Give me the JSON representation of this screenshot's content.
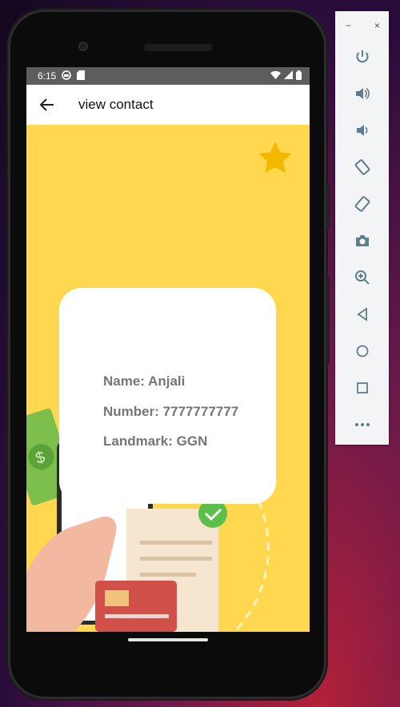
{
  "status_bar": {
    "time": "6:15"
  },
  "app_bar": {
    "title": "view contact",
    "back_icon": "arrow-back-icon"
  },
  "contact": {
    "name_line": "Name: Anjali",
    "number_line": "Number: 7777777777",
    "landmark_line": "Landmark: GGN"
  },
  "favorite_icon": "star-icon",
  "colors": {
    "screen_background": "#ffd84f",
    "star": "#f5b800",
    "card": "#ffffff",
    "card_text": "#767676",
    "status_bar": "#5d5d5d",
    "toolbar_icon": "#5f7d8c"
  },
  "emulator_toolbar": {
    "minimize_label": "−",
    "close_label": "×",
    "items": [
      "power-icon",
      "volume-up-icon",
      "volume-down-icon",
      "rotate-left-icon",
      "rotate-right-icon",
      "screenshot-icon",
      "zoom-icon",
      "back-icon",
      "home-icon",
      "overview-icon",
      "more-icon"
    ]
  }
}
